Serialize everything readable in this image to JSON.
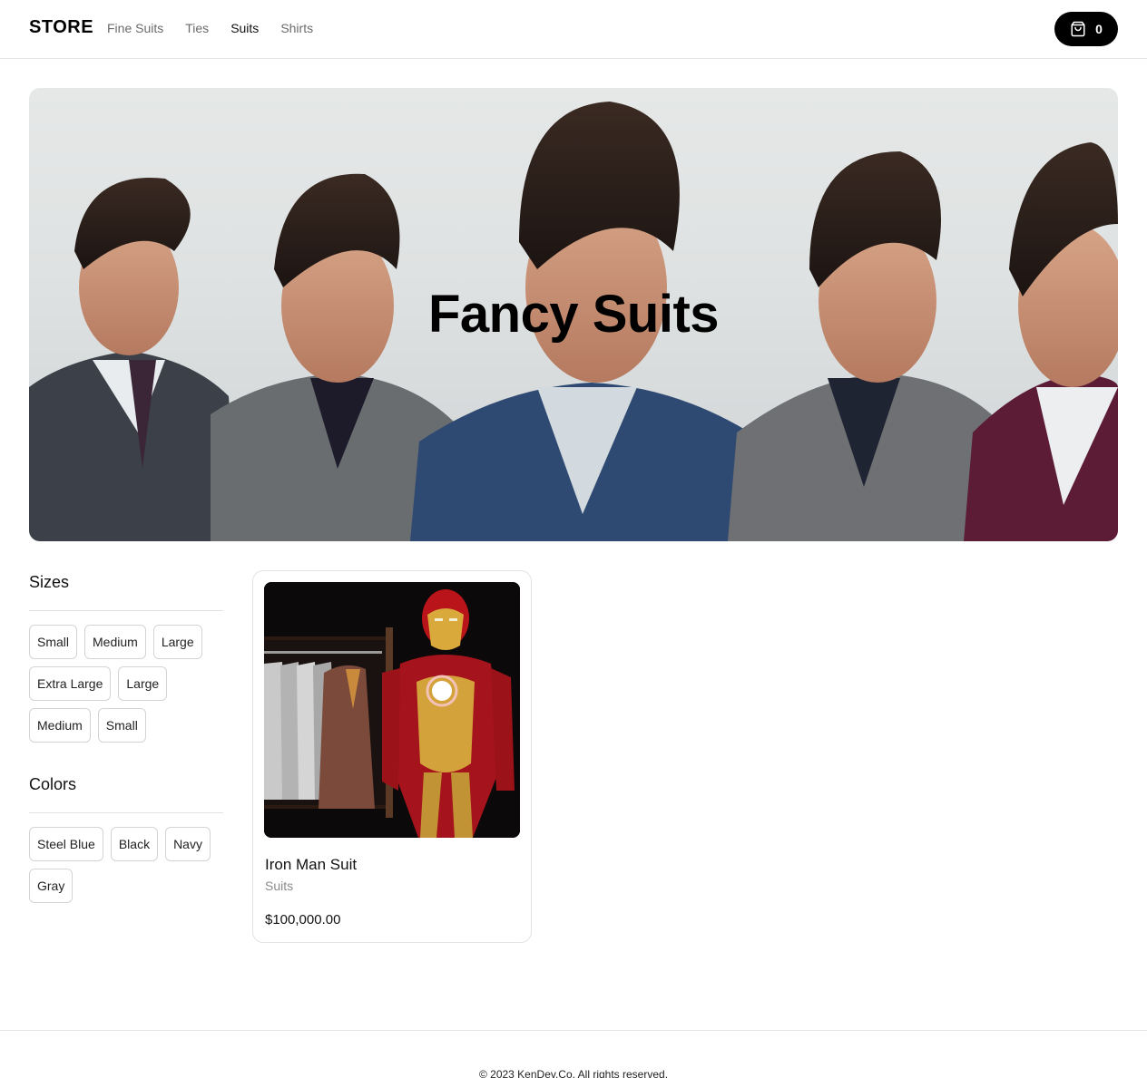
{
  "nav": {
    "logo": "STORE",
    "links": [
      {
        "label": "Fine Suits",
        "active": false
      },
      {
        "label": "Ties",
        "active": false
      },
      {
        "label": "Suits",
        "active": true
      },
      {
        "label": "Shirts",
        "active": false
      }
    ],
    "cart": {
      "icon": "shopping-bag-icon",
      "count": "0"
    }
  },
  "hero": {
    "title": "Fancy Suits",
    "image": "men-in-suits-photo"
  },
  "filters": {
    "sizes": {
      "title": "Sizes",
      "options": [
        "Small",
        "Medium",
        "Large",
        "Extra Large",
        "Large",
        "Medium",
        "Small"
      ]
    },
    "colors": {
      "title": "Colors",
      "options": [
        "Steel Blue",
        "Black",
        "Navy",
        "Gray"
      ]
    }
  },
  "products": [
    {
      "name": "Iron Man Suit",
      "category": "Suits",
      "price": "$100,000.00",
      "image": "iron-man-suit-photo"
    }
  ],
  "footer": {
    "text": "© 2023 KenDev.Co. All rights reserved."
  },
  "colors": {
    "accent": "#000000",
    "border": "#e5e5e5",
    "muted_text": "#6b6b6b"
  }
}
